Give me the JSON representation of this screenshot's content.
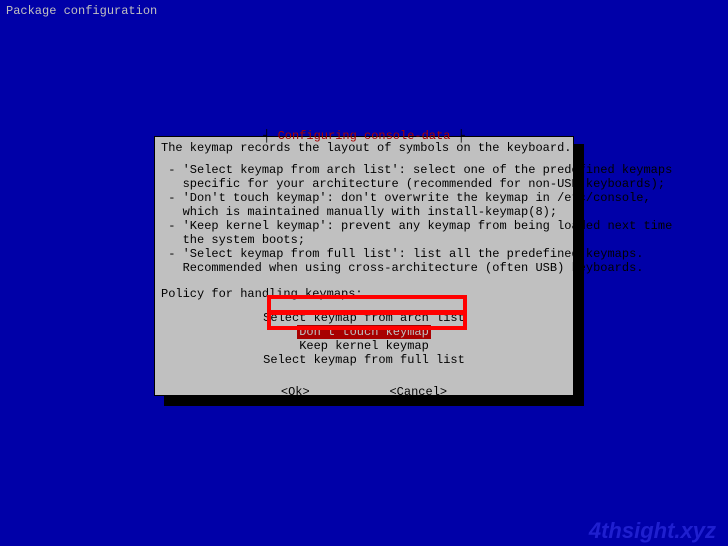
{
  "header": "Package configuration",
  "dialog": {
    "title_prefix": "┤ ",
    "title": "Configuring console-data",
    "title_suffix": " ├",
    "intro": "The keymap records the layout of symbols on the keyboard.",
    "bullets": [
      " - 'Select keymap from arch list': select one of the predefined keymaps\n   specific for your architecture (recommended for non-USB keyboards);",
      " - 'Don't touch keymap': don't overwrite the keymap in /etc/console,\n   which is maintained manually with install-keymap(8);",
      " - 'Keep kernel keymap': prevent any keymap from being loaded next time\n   the system boots;",
      " - 'Select keymap from full list': list all the predefined keymaps.\n   Recommended when using cross-architecture (often USB) keyboards."
    ],
    "prompt": "Policy for handling keymaps:",
    "options": [
      "Select keymap from arch list",
      "Don't touch keymap",
      "Keep kernel keymap",
      "Select keymap from full list"
    ],
    "selected_index": 1,
    "ok": "<Ok>",
    "cancel": "<Cancel>"
  },
  "watermark": "4thsight.xyz"
}
